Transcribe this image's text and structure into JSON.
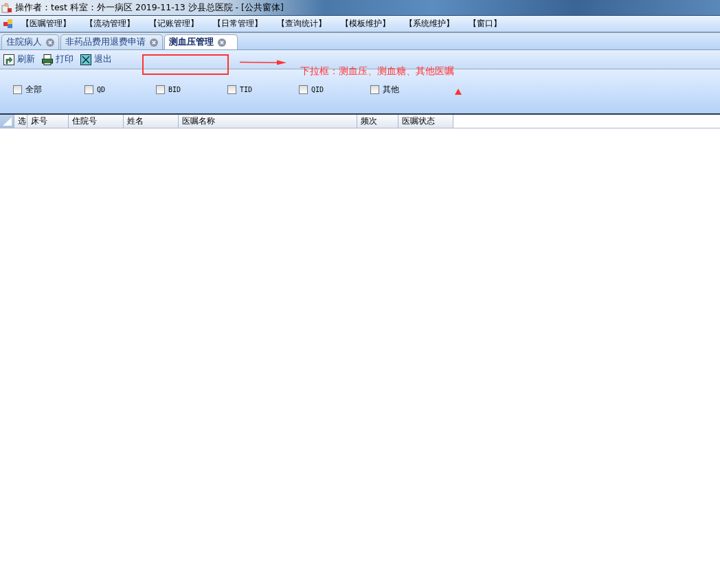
{
  "window": {
    "title": "操作者：test  科室：外一病区  2019-11-13  沙县总医院 - [公共窗体]"
  },
  "menu": [
    "【医嘱管理】",
    "【流动管理】",
    "【记账管理】",
    "【日常管理】",
    "【查询统计】",
    "【模板维护】",
    "【系统维护】",
    "【窗口】"
  ],
  "tabs": [
    {
      "label": "住院病人",
      "selected": false
    },
    {
      "label": "非药品费用退费申请",
      "selected": false
    },
    {
      "label": "测血压管理",
      "selected": true
    }
  ],
  "toolbar": [
    {
      "kind": "refresh",
      "label": "刷新"
    },
    {
      "kind": "print",
      "label": "打印"
    },
    {
      "kind": "exit",
      "label": "退出"
    }
  ],
  "filters": [
    {
      "label": "全部",
      "checked": false
    },
    {
      "label": "QD",
      "checked": false
    },
    {
      "label": "BID",
      "checked": false
    },
    {
      "label": "TID",
      "checked": false
    },
    {
      "label": "QID",
      "checked": false
    },
    {
      "label": "其他",
      "checked": false
    }
  ],
  "table": {
    "columns": [
      "选",
      "床号",
      "住院号",
      "姓名",
      "医嘱名称",
      "频次",
      "医嘱状态"
    ]
  },
  "annotation": {
    "text": "下拉框：测血压、测血糖、其他医嘱"
  }
}
